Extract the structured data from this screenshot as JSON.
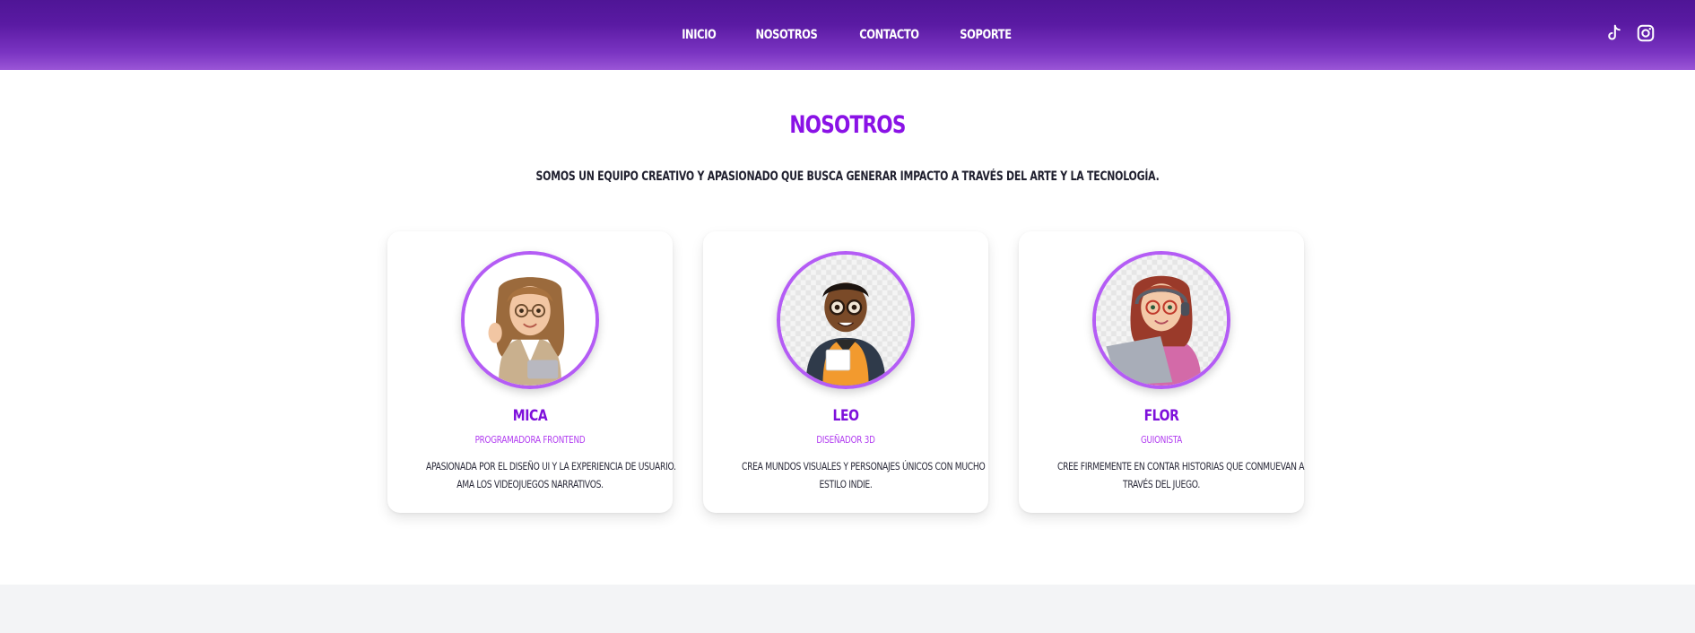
{
  "nav": {
    "links": [
      "INICIO",
      "NOSOTROS",
      "CONTACTO",
      "SOPORTE"
    ],
    "social_icons": [
      "tiktok-icon",
      "instagram-icon"
    ]
  },
  "about": {
    "title": "NOSOTROS",
    "description": "SOMOS UN EQUIPO CREATIVO Y APASIONADO QUE BUSCA GENERAR IMPACTO A TRAVÉS DEL ARTE Y LA TECNOLOGÍA."
  },
  "team": [
    {
      "name": "MICA",
      "role": "PROGRAMADORA FRONTEND",
      "bio_lines": [
        "APASIONADA POR EL DISEÑO UI Y LA EXPERIENCIA DE USUARIO.",
        "AMA LOS VIDEOJUEGOS NARRATIVOS."
      ]
    },
    {
      "name": "LEO",
      "role": "DISEÑADOR 3D",
      "bio_lines": [
        "CREA MUNDOS VISUALES Y PERSONAJES ÚNICOS CON MUCHO",
        "ESTILO INDIE."
      ]
    },
    {
      "name": "FLOR",
      "role": "GUIONISTA",
      "bio_lines": [
        "CREE FIRMEMENTE EN CONTAR HISTORIAS QUE CONMUEVAN A",
        "TRAVÉS DEL JUEGO."
      ]
    }
  ],
  "colors": {
    "nav_gradient_top": "#4f1596",
    "nav_gradient_bottom": "#9a55d6",
    "accent_purple": "#8a12e6",
    "role_purple": "#b13cf0",
    "avatar_border": "#b45cf5",
    "footer_band": "#f3f4f6"
  }
}
